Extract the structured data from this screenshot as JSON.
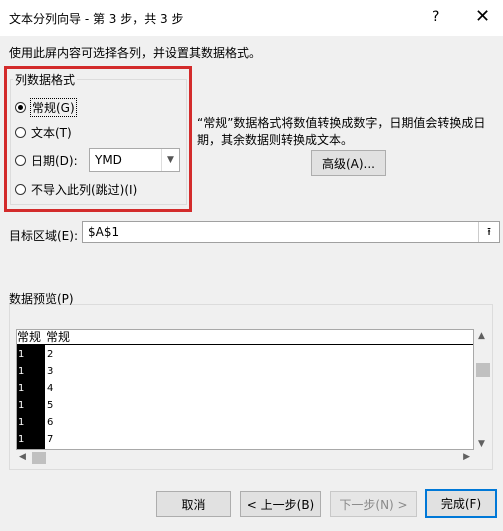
{
  "window": {
    "title": "文本分列向导 - 第 3 步，共 3 步",
    "help_label": "?",
    "close_label": "✕"
  },
  "instruction": "使用此屏内容可选择各列，并设置其数据格式。",
  "column_format": {
    "title": "列数据格式",
    "options": [
      {
        "label": "常规(G)",
        "checked": true
      },
      {
        "label": "文本(T)",
        "checked": false
      },
      {
        "label": "日期(D):",
        "checked": false
      },
      {
        "label": "不导入此列(跳过)(I)",
        "checked": false
      }
    ],
    "date_format": "YMD"
  },
  "description": {
    "line1": "“常规”数据格式将数值转换成数字，日期值会转换成日",
    "line2": "期，其余数据则转换成文本。"
  },
  "advanced_button": "高级(A)...",
  "destination": {
    "label": "目标区域(E):",
    "value": "$A$1",
    "collapse_icon": "⭱"
  },
  "preview": {
    "label": "数据预览(P)",
    "headers": [
      "常规",
      "常规"
    ],
    "rows": [
      [
        "1",
        "2"
      ],
      [
        "1",
        "3"
      ],
      [
        "1",
        "4"
      ],
      [
        "1",
        "5"
      ],
      [
        "1",
        "6"
      ],
      [
        "1",
        "7"
      ]
    ]
  },
  "buttons": {
    "cancel": "取消",
    "back": "< 上一步(B)",
    "next": "下一步(N) >",
    "finish": "完成(F)"
  }
}
